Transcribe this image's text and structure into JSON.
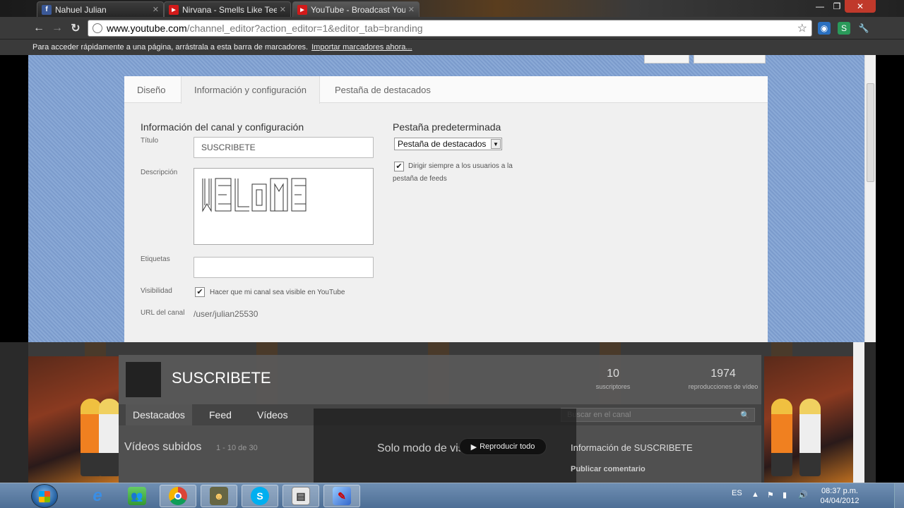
{
  "browser": {
    "tabs": [
      {
        "label": "Nahuel Julian",
        "favicon": "facebook-icon"
      },
      {
        "label": "Nirvana - Smells Like Teen",
        "favicon": "youtube-icon"
      },
      {
        "label": "YouTube - Broadcast Yours",
        "favicon": "youtube-icon"
      }
    ],
    "url_domain": "www.youtube.com",
    "url_path": "/channel_editor?action_editor=1&editor_tab=branding",
    "bookmarks_text": "Para acceder rápidamente a una página, arrástrala a esta barra de marcadores.",
    "bookmarks_link": "Importar marcadores ahora..."
  },
  "editor": {
    "tabs": [
      "Diseño",
      "Información y configuración",
      "Pestaña de destacados"
    ],
    "selected_tab": "Información y configuración",
    "section_title": "Información del canal y configuración",
    "title_label": "Título",
    "title_value": "SUSCRIBETE",
    "description_label": "Descripción",
    "description_value": "WELCOME",
    "tags_label": "Etiquetas",
    "tags_value": "",
    "visibility_label": "Visibilidad",
    "visibility_checked": true,
    "visibility_text": "Hacer que mi canal sea visible en YouTube",
    "url_label": "URL del canal",
    "url_value": "/user/julian25530",
    "default_tab_title": "Pestaña predeterminada",
    "default_tab_value": "Pestaña de destacados",
    "feeds_checked": true,
    "feeds_text_1": "Dirigir siempre a los usuarios a la",
    "feeds_text_2": "pestaña de feeds"
  },
  "preview": {
    "channel_name": "SUSCRIBETE",
    "subscribers": "10",
    "subscribers_label": "suscriptores",
    "views": "1974",
    "views_label": "reproducciones de vídeo",
    "nav": [
      "Destacados",
      "Feed",
      "Vídeos"
    ],
    "search_placeholder": "Buscar en el canal",
    "uploads_title": "Vídeos subidos",
    "uploads_count": "1 - 10 de 30",
    "overlay_text": "Solo modo de vista previa",
    "play_all": "Reproducir todo",
    "info_title": "Información de SUSCRIBETE",
    "comment_label": "Publicar comentario"
  },
  "taskbar": {
    "language": "ES",
    "time": "08:37 p.m.",
    "date": "04/04/2012",
    "apps": [
      "internet-explorer-icon",
      "contacts-icon",
      "chrome-icon",
      "game-icon",
      "skype-icon",
      "window-app-icon",
      "paint-app-icon"
    ]
  },
  "colors": {
    "page_bg": "#8aa9d6",
    "taskbar": "#5a7aa3",
    "youtube_red": "#d21a1a"
  }
}
